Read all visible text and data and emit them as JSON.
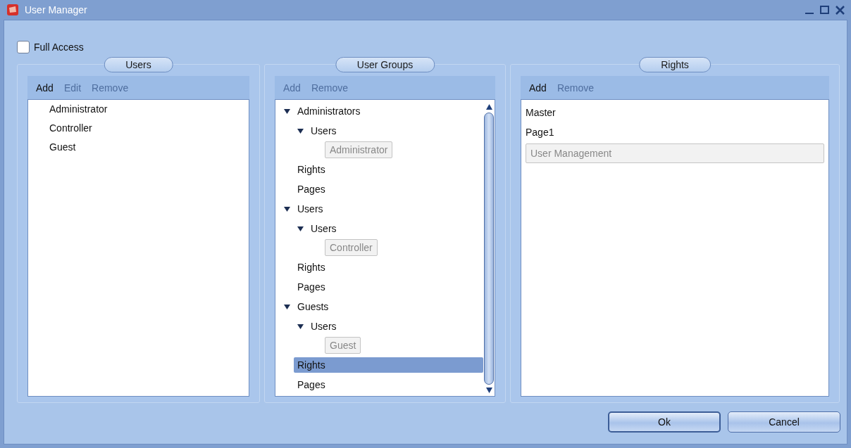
{
  "window": {
    "title": "User Manager"
  },
  "full_access": {
    "label": "Full Access",
    "checked": false
  },
  "users_panel": {
    "title": "Users",
    "toolbar": [
      {
        "label": "Add",
        "disabled": false
      },
      {
        "label": "Edit",
        "disabled": true
      },
      {
        "label": "Remove",
        "disabled": true
      }
    ],
    "items": [
      {
        "label": "Administrator",
        "selected": false
      },
      {
        "label": "Controller",
        "selected": false
      },
      {
        "label": "Guest",
        "selected": false
      }
    ]
  },
  "groups_panel": {
    "title": "User Groups",
    "toolbar": [
      {
        "label": "Add",
        "disabled": true
      },
      {
        "label": "Remove",
        "disabled": true
      }
    ],
    "tree": [
      {
        "label": "Administrators",
        "kind": "node",
        "expanded": true,
        "selected": false,
        "children": [
          {
            "label": "Users",
            "kind": "node",
            "expanded": true,
            "selected": false,
            "children": [
              {
                "label": "Administrator",
                "kind": "chip",
                "selected": false
              }
            ]
          },
          {
            "label": "Rights",
            "kind": "node",
            "selected": false
          },
          {
            "label": "Pages",
            "kind": "node",
            "selected": false
          }
        ]
      },
      {
        "label": "Users",
        "kind": "node",
        "expanded": true,
        "selected": false,
        "children": [
          {
            "label": "Users",
            "kind": "node",
            "expanded": true,
            "selected": false,
            "children": [
              {
                "label": "Controller",
                "kind": "chip",
                "selected": false
              }
            ]
          },
          {
            "label": "Rights",
            "kind": "node",
            "selected": false
          },
          {
            "label": "Pages",
            "kind": "node",
            "selected": false
          }
        ]
      },
      {
        "label": "Guests",
        "kind": "node",
        "expanded": true,
        "selected": false,
        "children": [
          {
            "label": "Users",
            "kind": "node",
            "expanded": true,
            "selected": false,
            "children": [
              {
                "label": "Guest",
                "kind": "chip",
                "selected": false
              }
            ]
          },
          {
            "label": "Rights",
            "kind": "node",
            "selected": true
          },
          {
            "label": "Pages",
            "kind": "node",
            "selected": false
          }
        ]
      }
    ]
  },
  "rights_panel": {
    "title": "Rights",
    "toolbar": [
      {
        "label": "Add",
        "disabled": false
      },
      {
        "label": "Remove",
        "disabled": true
      }
    ],
    "items": [
      {
        "label": "Master",
        "kind": "item"
      },
      {
        "label": "Page1",
        "kind": "item"
      },
      {
        "label": "User Management",
        "kind": "chip"
      }
    ]
  },
  "buttons": [
    {
      "label": "Ok",
      "default": true
    },
    {
      "label": "Cancel",
      "default": false
    }
  ]
}
